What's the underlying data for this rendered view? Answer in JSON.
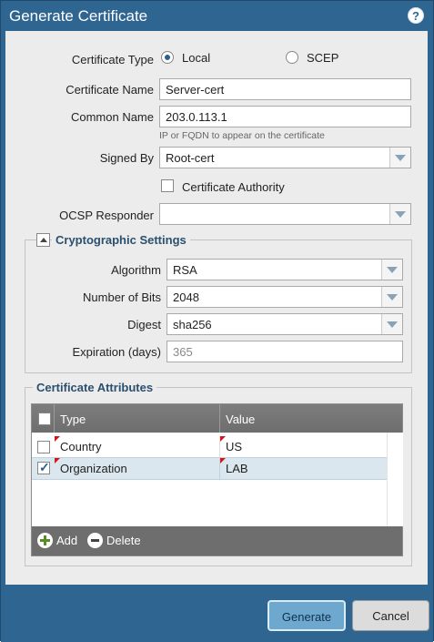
{
  "dialog": {
    "title": "Generate Certificate",
    "help_glyph": "?"
  },
  "form": {
    "certificate_type_label": "Certificate Type",
    "type_local": "Local",
    "type_scep": "SCEP",
    "certificate_name_label": "Certificate Name",
    "certificate_name_value": "Server-cert",
    "common_name_label": "Common Name",
    "common_name_value": "203.0.113.1",
    "common_name_hint": "IP or FQDN to appear on the certificate",
    "signed_by_label": "Signed By",
    "signed_by_value": "Root-cert",
    "certificate_authority_label": "Certificate Authority",
    "ocsp_label": "OCSP Responder",
    "ocsp_value": ""
  },
  "crypto": {
    "title": "Cryptographic Settings",
    "algorithm_label": "Algorithm",
    "algorithm_value": "RSA",
    "bits_label": "Number of Bits",
    "bits_value": "2048",
    "digest_label": "Digest",
    "digest_value": "sha256",
    "expiration_label": "Expiration (days)",
    "expiration_placeholder": "365"
  },
  "attributes": {
    "title": "Certificate Attributes",
    "columns": [
      "Type",
      "Value"
    ],
    "rows": [
      {
        "type": "Country",
        "value": "US",
        "checked": false
      },
      {
        "type": "Organization",
        "value": "LAB",
        "checked": true
      }
    ],
    "add_label": "Add",
    "delete_label": "Delete"
  },
  "buttons": {
    "generate": "Generate",
    "cancel": "Cancel"
  }
}
